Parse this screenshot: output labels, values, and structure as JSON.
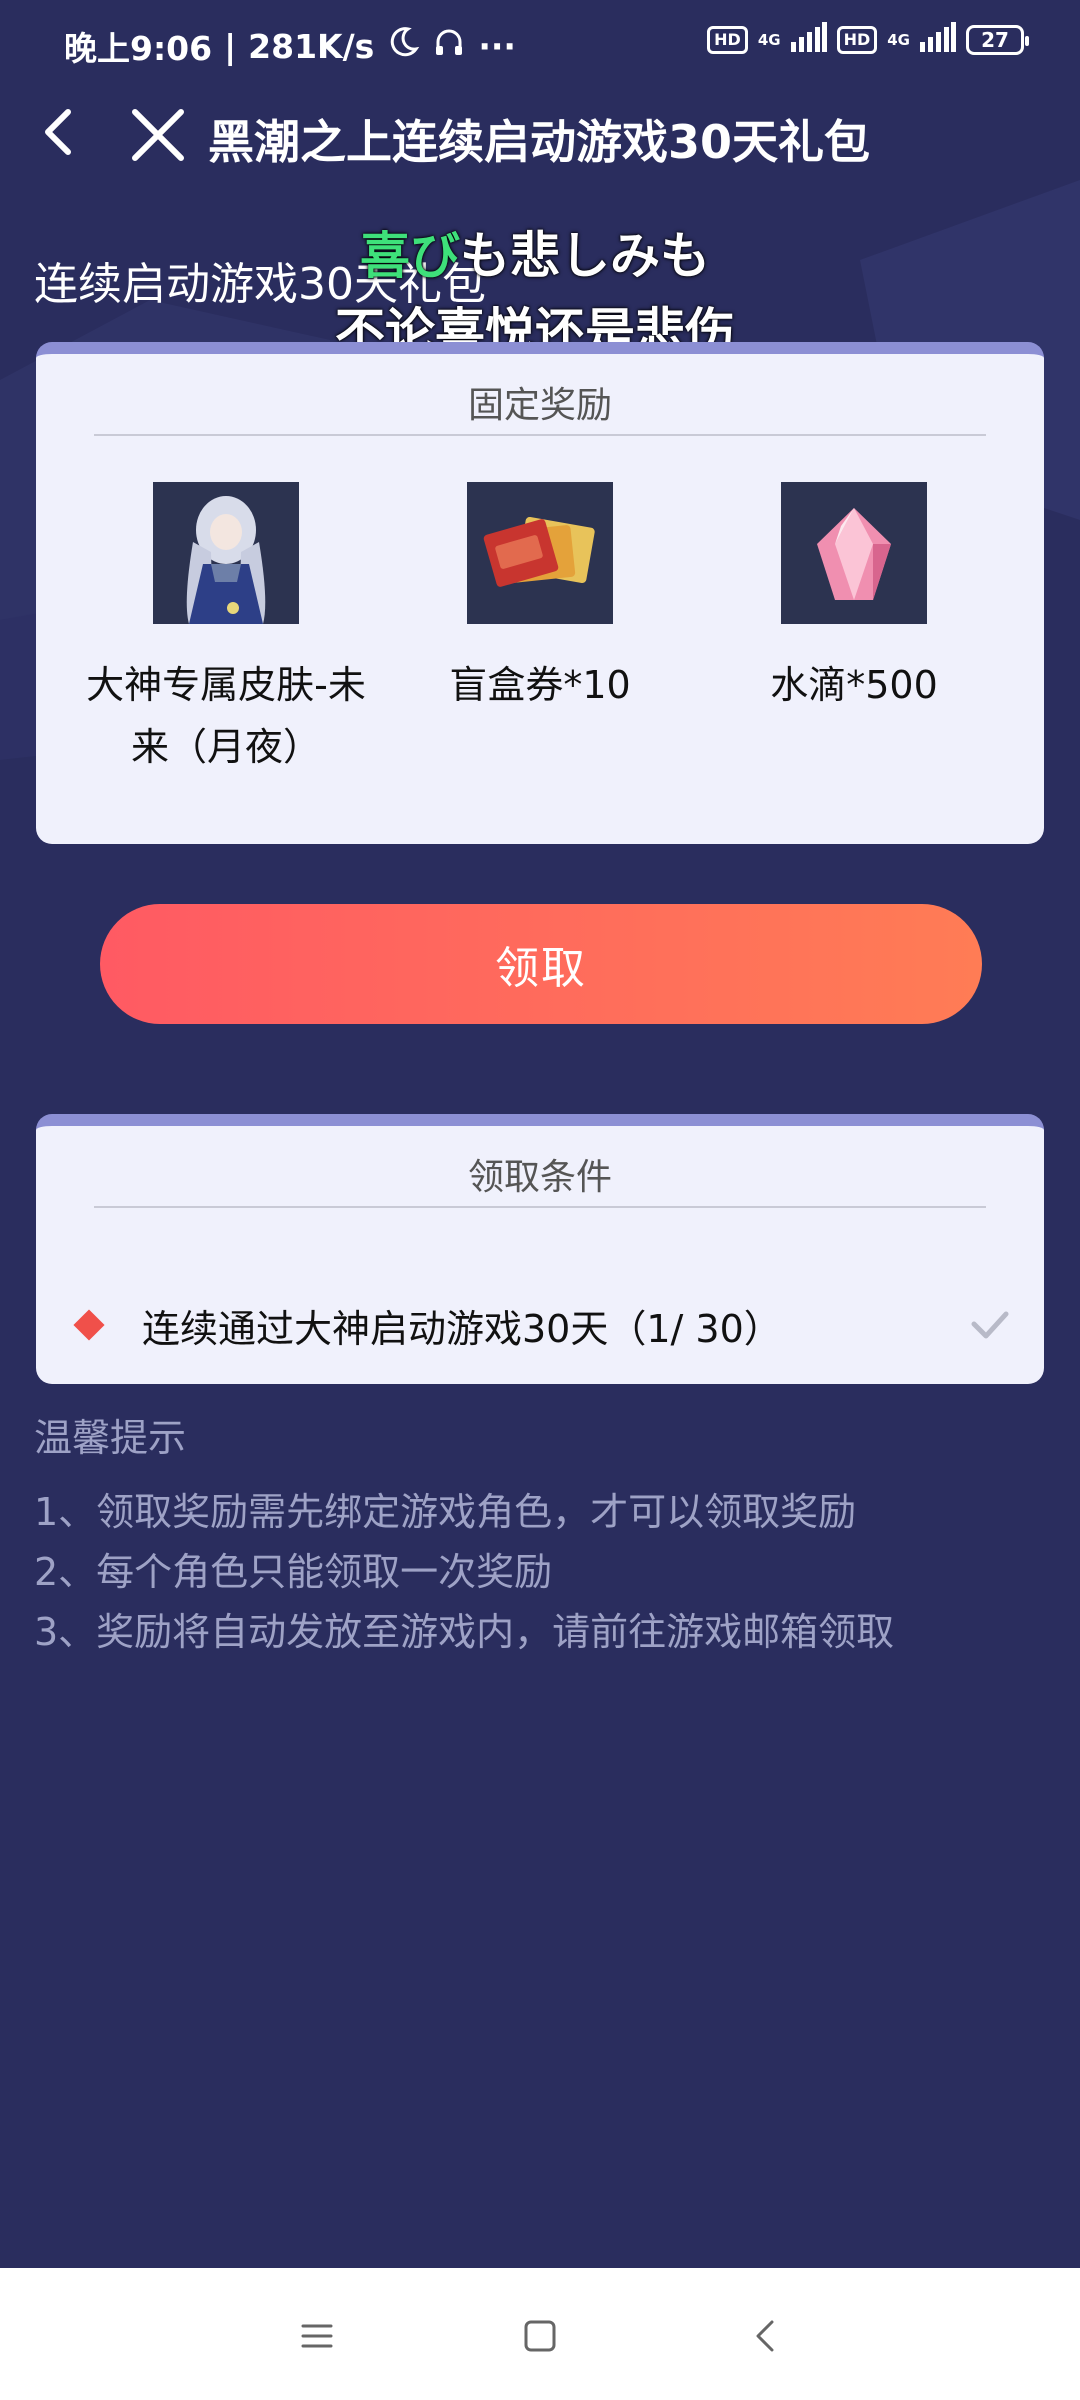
{
  "status_bar": {
    "time": "晚上9:06",
    "speed": "281K/s",
    "more": "···",
    "hd1": "HD",
    "net1": "4G",
    "hd2": "HD",
    "net2": "4G",
    "battery": "27"
  },
  "nav": {
    "title": "黑潮之上连续启动游戏30天礼包"
  },
  "page": {
    "heading": "连续启动游戏30天礼包"
  },
  "overlay": {
    "lyric_line1_highlight": "喜び",
    "lyric_line1_rest": "も悲しみも",
    "lyric_line2": "不论喜悦还是悲伤"
  },
  "rewards_card": {
    "title": "固定奖励",
    "items": [
      {
        "label": "大神专属皮肤-未来（月夜）",
        "icon": "character-skin-icon"
      },
      {
        "label": "盲盒券*10",
        "icon": "ticket-icon"
      },
      {
        "label": "水滴*500",
        "icon": "water-crystal-icon"
      }
    ]
  },
  "claim_button": {
    "label": "领取"
  },
  "conditions_card": {
    "title": "领取条件",
    "condition": "连续通过大神启动游戏30天（1/ 30）"
  },
  "tips": {
    "title": "温馨提示",
    "items": [
      "1、领取奖励需先绑定游戏角色，才可以领取奖励",
      "2、每个角色只能领取一次奖励",
      "3、奖励将自动发放至游戏内，请前往游戏邮箱领取"
    ]
  },
  "colors": {
    "background": "#2a2d5e",
    "card": "#f0f1fc",
    "accent_button": "#ff5a63",
    "tips_text": "#9ea2c6"
  }
}
